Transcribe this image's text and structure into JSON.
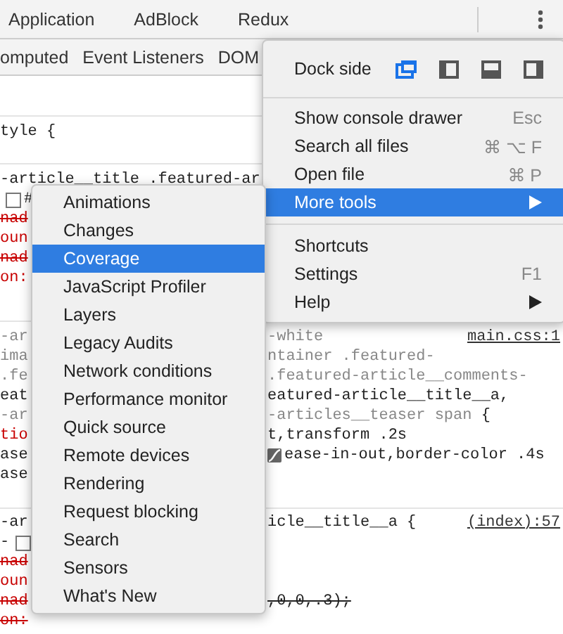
{
  "panel_tabs": [
    {
      "label": "Application",
      "selected": false
    },
    {
      "label": "AdBlock",
      "selected": false
    },
    {
      "label": "Redux",
      "selected": false
    }
  ],
  "sidebar_tabs": [
    {
      "label": "omputed",
      "selected": false
    },
    {
      "label": "Event Listeners",
      "selected": false
    },
    {
      "label": "DOM",
      "selected": false
    }
  ],
  "style_rule": "tyle {",
  "rule_blocks": [
    {
      "lines": [
        {
          "left": [
            {
              "kind": "plain",
              "text": "-article__title .featured-ar"
            }
          ]
        },
        {
          "left": [
            {
              "kind": "checkbox",
              "checked": false
            },
            {
              "kind": "plain",
              "text": "#"
            }
          ]
        },
        {
          "left": [
            {
              "kind": "red_struck",
              "text": "nad"
            }
          ]
        },
        {
          "left": [
            {
              "kind": "red",
              "text": "oun"
            }
          ]
        },
        {
          "left": [
            {
              "kind": "red_struck",
              "text": "nad"
            }
          ]
        },
        {
          "left": [
            {
              "kind": "red",
              "text": "on:"
            }
          ]
        }
      ]
    },
    {
      "lines": [
        {
          "left": [
            {
              "kind": "gray",
              "text": "-ar"
            }
          ],
          "right": [
            {
              "kind": "gray",
              "text": "-white"
            }
          ],
          "source": "main.css:1"
        },
        {
          "left": [
            {
              "kind": "gray",
              "text": "ima"
            }
          ],
          "right": [
            {
              "kind": "gray",
              "text": "ntainer .featured-"
            }
          ]
        },
        {
          "left": [
            {
              "kind": "gray",
              "text": ".fe"
            }
          ],
          "right": [
            {
              "kind": "gray",
              "text": ".featured-article__comments-"
            }
          ]
        },
        {
          "left": [
            {
              "kind": "plain",
              "text": "eat"
            }
          ],
          "right": [
            {
              "kind": "plain",
              "text": "eatured-article__title__a,"
            }
          ]
        },
        {
          "left": [
            {
              "kind": "gray",
              "text": "-ar"
            }
          ],
          "right": [
            {
              "kind": "gray",
              "text": "-articles__teaser span "
            },
            {
              "kind": "plain",
              "text": "{"
            }
          ]
        },
        {
          "left": [
            {
              "kind": "red",
              "text": "tio"
            }
          ],
          "right": [
            {
              "kind": "plain",
              "text": "t,transform .2s"
            }
          ]
        },
        {
          "left": [
            {
              "kind": "plain",
              "text": "ase"
            }
          ],
          "right": [
            {
              "kind": "easing"
            },
            {
              "kind": "plain",
              "text": "ease-in-out,border-color .4s"
            }
          ]
        },
        {
          "left": [
            {
              "kind": "plain",
              "text": "ase"
            }
          ]
        }
      ]
    },
    {
      "lines": [
        {
          "left": [
            {
              "kind": "plain",
              "text": "-ar"
            }
          ],
          "right": [
            {
              "kind": "plain",
              "text": "icle__title__a {"
            }
          ],
          "source": "(index):57"
        },
        {
          "left": [
            {
              "kind": "plain",
              "text": "-"
            },
            {
              "kind": "checkbox",
              "checked": false
            }
          ]
        },
        {
          "left": [
            {
              "kind": "red_struck",
              "text": "nad"
            }
          ]
        },
        {
          "left": [
            {
              "kind": "red",
              "text": "oun"
            }
          ]
        },
        {
          "left": [
            {
              "kind": "red_struck",
              "text": "nad"
            }
          ],
          "right": [
            {
              "kind": "struck",
              "text": ",0,0,.3);"
            }
          ]
        },
        {
          "left": [
            {
              "kind": "red_struck",
              "text": "on:"
            }
          ]
        }
      ]
    }
  ],
  "main_menu": {
    "dock_label": "Dock side",
    "dock_options": [
      {
        "kind": "undock",
        "selected": true
      },
      {
        "kind": "left",
        "selected": false
      },
      {
        "kind": "bottom",
        "selected": false
      },
      {
        "kind": "right",
        "selected": false
      }
    ],
    "items": [
      {
        "kind": "item",
        "label": "Show console drawer",
        "shortcut": "Esc",
        "selected": false
      },
      {
        "kind": "item",
        "label": "Search all files",
        "shortcut": "⌘ ⌥ F",
        "selected": false
      },
      {
        "kind": "item",
        "label": "Open file",
        "shortcut": "⌘ P",
        "selected": false
      },
      {
        "kind": "submenu",
        "label": "More tools",
        "selected": true
      },
      {
        "kind": "separator"
      },
      {
        "kind": "item",
        "label": "Shortcuts",
        "selected": false
      },
      {
        "kind": "item",
        "label": "Settings",
        "shortcut": "F1",
        "selected": false
      },
      {
        "kind": "submenu",
        "label": "Help",
        "selected": false
      }
    ]
  },
  "more_tools_menu": [
    {
      "label": "Animations",
      "selected": false
    },
    {
      "label": "Changes",
      "selected": false
    },
    {
      "label": "Coverage",
      "selected": true
    },
    {
      "label": "JavaScript Profiler",
      "selected": false
    },
    {
      "label": "Layers",
      "selected": false
    },
    {
      "label": "Legacy Audits",
      "selected": false
    },
    {
      "label": "Network conditions",
      "selected": false
    },
    {
      "label": "Performance monitor",
      "selected": false
    },
    {
      "label": "Quick source",
      "selected": false
    },
    {
      "label": "Remote devices",
      "selected": false
    },
    {
      "label": "Rendering",
      "selected": false
    },
    {
      "label": "Request blocking",
      "selected": false
    },
    {
      "label": "Search",
      "selected": false
    },
    {
      "label": "Sensors",
      "selected": false
    },
    {
      "label": "What's New",
      "selected": false
    }
  ]
}
